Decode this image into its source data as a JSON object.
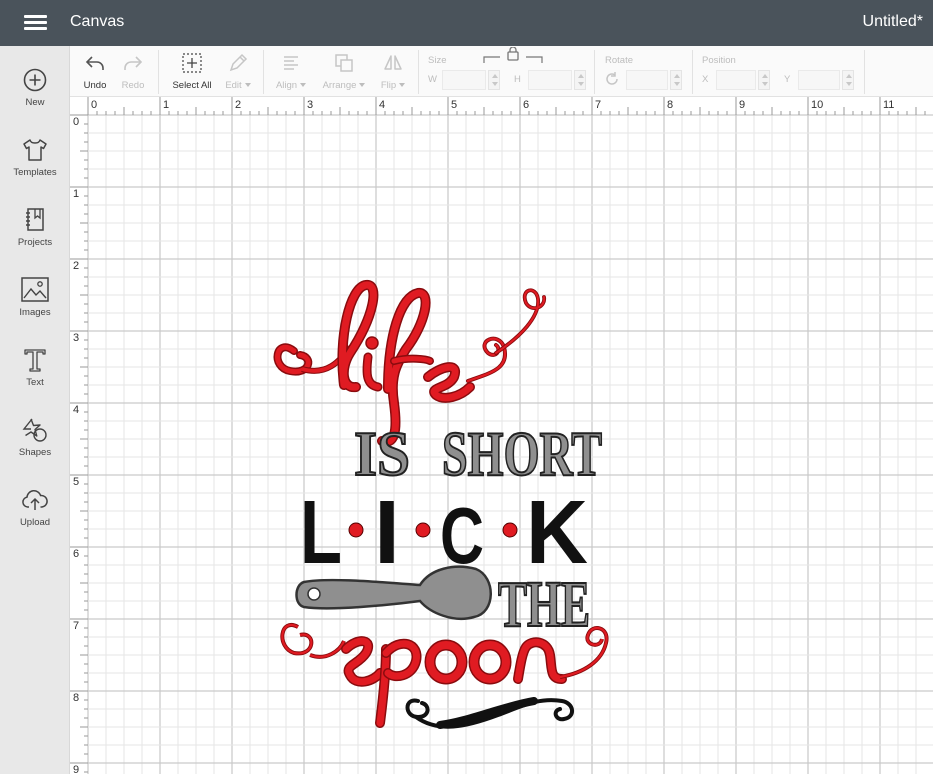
{
  "header": {
    "app_title": "Canvas",
    "document_title": "Untitled*"
  },
  "sidebar": {
    "items": [
      {
        "label": "New",
        "icon": "plus-circle-icon"
      },
      {
        "label": "Templates",
        "icon": "tshirt-icon"
      },
      {
        "label": "Projects",
        "icon": "notebook-icon"
      },
      {
        "label": "Images",
        "icon": "image-icon"
      },
      {
        "label": "Text",
        "icon": "text-t-icon"
      },
      {
        "label": "Shapes",
        "icon": "shapes-icon"
      },
      {
        "label": "Upload",
        "icon": "cloud-upload-icon"
      }
    ]
  },
  "toolbar": {
    "undo": "Undo",
    "redo": "Redo",
    "select_all": "Select All",
    "edit": "Edit",
    "align": "Align",
    "arrange": "Arrange",
    "flip": "Flip",
    "size_label": "Size",
    "w_label": "W",
    "h_label": "H",
    "rotate_label": "Rotate",
    "position_label": "Position",
    "x_label": "X",
    "y_label": "Y"
  },
  "rulers": {
    "horizontal": [
      "0",
      "1",
      "2",
      "3",
      "4",
      "5",
      "6",
      "7",
      "8",
      "9",
      "10",
      "11"
    ],
    "vertical": [
      "0",
      "1",
      "2",
      "3",
      "4",
      "5",
      "6",
      "7",
      "8",
      "9"
    ]
  },
  "design": {
    "words": [
      "life",
      "IS SHORT",
      "L·I·C·K",
      "THE",
      "spoon"
    ],
    "colors": {
      "red": "#e01b22",
      "gray": "#8f8f8f",
      "black": "#111111"
    }
  },
  "theme": {
    "header_bg": "#4a535b",
    "sidebar_bg": "#e8e8e8",
    "toolbar_bg": "#fafafa"
  }
}
